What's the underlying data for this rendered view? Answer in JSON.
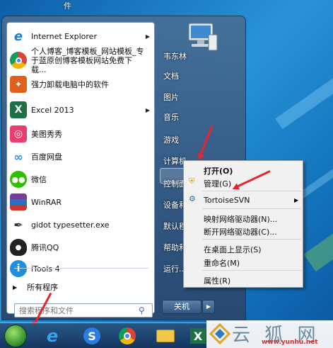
{
  "top_text": "件",
  "start_menu": {
    "programs": [
      {
        "label": "Internet Explorer",
        "icon": "ie-icon",
        "has_arrow": true
      },
      {
        "label": "个人博客_博客模板_网站模板_专于蓝原创博客模板网站免费下载...",
        "icon": "chrome-icon",
        "has_arrow": false
      },
      {
        "label": "强力卸载电脑中的软件",
        "icon": "uninstall-icon",
        "has_arrow": false
      },
      {
        "label": "Excel 2013",
        "icon": "excel-icon",
        "has_arrow": true
      },
      {
        "label": "美图秀秀",
        "icon": "meitu-icon",
        "has_arrow": false
      },
      {
        "label": "百度网盘",
        "icon": "baidu-netdisk-icon",
        "has_arrow": false
      },
      {
        "label": "微信",
        "icon": "wechat-icon",
        "has_arrow": false
      },
      {
        "label": "WinRAR",
        "icon": "winrar-icon",
        "has_arrow": false
      },
      {
        "label": "gidot typesetter.exe",
        "icon": "pen-nib-icon",
        "has_arrow": false
      },
      {
        "label": "腾讯QQ",
        "icon": "qq-icon",
        "has_arrow": false
      },
      {
        "label": "iTools 4",
        "icon": "itools-icon",
        "has_arrow": false
      }
    ],
    "all_programs": "所有程序",
    "search_placeholder": "搜索程序和文件",
    "right_items": {
      "user": "韦东林",
      "documents": "文档",
      "pictures": "图片",
      "music": "音乐",
      "games": "游戏",
      "computer": "计算机",
      "control_panel": "控制面",
      "devices": "设备和",
      "default_programs": "默认程",
      "help": "帮助和",
      "run": "运行..."
    },
    "shutdown": "关机"
  },
  "context_menu": {
    "items": [
      {
        "label": "打开(O)",
        "bold": true
      },
      {
        "label": "管理(G)",
        "bold": false
      },
      {
        "label": "TortoiseSVN",
        "bold": false
      },
      {
        "label": "映射网络驱动器(N)...",
        "bold": false
      },
      {
        "label": "断开网络驱动器(C)...",
        "bold": false
      },
      {
        "label": "在桌面上显示(S)",
        "bold": false
      },
      {
        "label": "重命名(M)",
        "bold": false
      },
      {
        "label": "属性(R)",
        "bold": false
      }
    ]
  },
  "taskbar": {
    "icons": [
      "start-orb-icon",
      "ie-icon",
      "sogou-icon",
      "chrome-icon",
      "folder-icon",
      "excel-icon"
    ]
  },
  "watermark": {
    "text": "云 狐 网",
    "url": "www.yunhu.net"
  },
  "colors": {
    "arrow_red": "#e8252e",
    "menu_bg": "#f1f1f1",
    "desktop_blue": "#1d7fc4"
  }
}
